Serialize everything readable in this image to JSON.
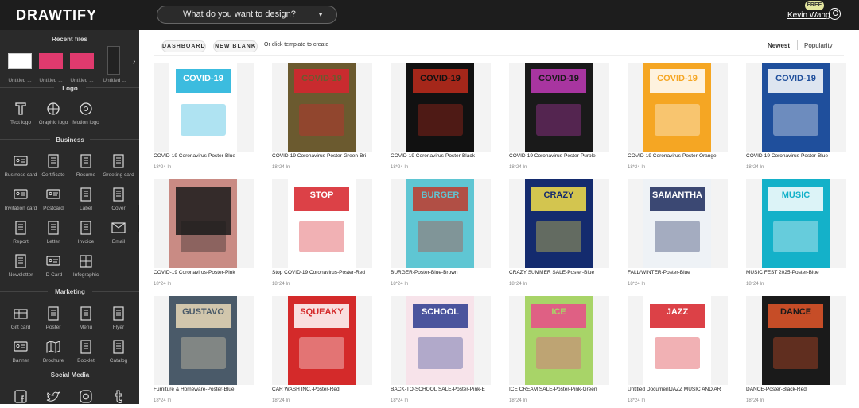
{
  "app": {
    "logo": "DRAWTIFY"
  },
  "search": {
    "placeholder": "What do you want to design?"
  },
  "user": {
    "badge": "FREE",
    "name": "Kevin Wang"
  },
  "sidebar": {
    "recent_title": "Recent files",
    "recent": [
      "Untitled ...",
      "Untitled ...",
      "Untitled ...",
      "Untitled ..."
    ],
    "logo_title": "Logo",
    "logo_items": [
      "Text logo",
      "Graphic logo",
      "Motion logo"
    ],
    "business_title": "Business",
    "business_items": [
      "Business card",
      "Certificate",
      "Resume",
      "Greeting card",
      "Invitation card",
      "Postcard",
      "Label",
      "Cover",
      "Report",
      "Letter",
      "Invoice",
      "Email",
      "Newsletter",
      "ID Card",
      "Infographic"
    ],
    "marketing_title": "Marketing",
    "marketing_items": [
      "Gift card",
      "Poster",
      "Menu",
      "Flyer",
      "Banner",
      "Brochure",
      "Booklet",
      "Catalog"
    ],
    "social_title": "Social Media"
  },
  "main": {
    "dashboard_label": "DASHBOARD",
    "new_blank_label": "NEW BLANK",
    "hint": "Or click template to create",
    "sort_newest": "Newest",
    "sort_popularity": "Popularity",
    "size_label": "18*24 In"
  },
  "templates": [
    {
      "title": "COVID-19 Coronavirus-Poster-Blue",
      "bg": "#ffffff",
      "accent": "#1ab0d9",
      "poster": "COVID-19"
    },
    {
      "title": "COVID-19 Coronavirus-Poster-Green-Bri",
      "bg": "#6b5a2f",
      "accent": "#d9232f",
      "poster": "COVID-19"
    },
    {
      "title": "COVID-19 Coronavirus-Poster-Black",
      "bg": "#111111",
      "accent": "#c02b1c",
      "poster": "COVID-19"
    },
    {
      "title": "COVID-19 Coronavirus-Poster-Purple",
      "bg": "#1a1a1a",
      "accent": "#c23bb8",
      "poster": "COVID-19"
    },
    {
      "title": "COVID-19 Coronavirus-Poster-Orange",
      "bg": "#f5a623",
      "accent": "#ffffff",
      "poster": "COVID-19"
    },
    {
      "title": "COVID-19 Coronavirus-Poster-Blue",
      "bg": "#1f4f9c",
      "accent": "#ffffff",
      "poster": "COVID-19"
    },
    {
      "title": "COVID-19 Coronavirus-Poster-Pink",
      "bg": "#c98b84",
      "accent": "#1a1a1a",
      "poster": ""
    },
    {
      "title": "Stop COVID-19 Coronavirus-Poster-Red",
      "bg": "#ffffff",
      "accent": "#d62027",
      "poster": "STOP"
    },
    {
      "title": "BURGER-Poster-Blue-Brown",
      "bg": "#5fc6d3",
      "accent": "#c0392b",
      "poster": "BURGER"
    },
    {
      "title": "CRAZY SUMMER SALE-Poster-Blue",
      "bg": "#142b6e",
      "accent": "#f5e14a",
      "poster": "CRAZY"
    },
    {
      "title": "FALL/WINTER-Poster-Blue",
      "bg": "#eef2f6",
      "accent": "#1b2a5c",
      "poster": "SAMANTHA"
    },
    {
      "title": "MUSIC FEST 2025-Poster-Blue",
      "bg": "#14b1c9",
      "accent": "#ffffff",
      "poster": "MUSIC"
    },
    {
      "title": "Furniture & Homeware-Poster-Blue",
      "bg": "#4a5a69",
      "accent": "#e9d9b8",
      "poster": "GUSTAVO"
    },
    {
      "title": "CAR WASH INC.-Poster-Red",
      "bg": "#d42a2a",
      "accent": "#ffffff",
      "poster": "SQUEAKY"
    },
    {
      "title": "BACK-TO-SCHOOL SALE-Poster-Pink-E",
      "bg": "#f7e3ea",
      "accent": "#2d3b8f",
      "poster": "SCHOOL"
    },
    {
      "title": "ICE CREAM SALE-Poster-Pink-Green",
      "bg": "#a8d468",
      "accent": "#e94b8a",
      "poster": "ICE"
    },
    {
      "title": "Untitled DocumentJAZZ MUSIC AND AR",
      "bg": "#ffffff",
      "accent": "#d62027",
      "poster": "JAZZ"
    },
    {
      "title": "DANCE-Poster-Black-Red",
      "bg": "#1a1a1a",
      "accent": "#e5572a",
      "poster": "DANCE"
    }
  ]
}
